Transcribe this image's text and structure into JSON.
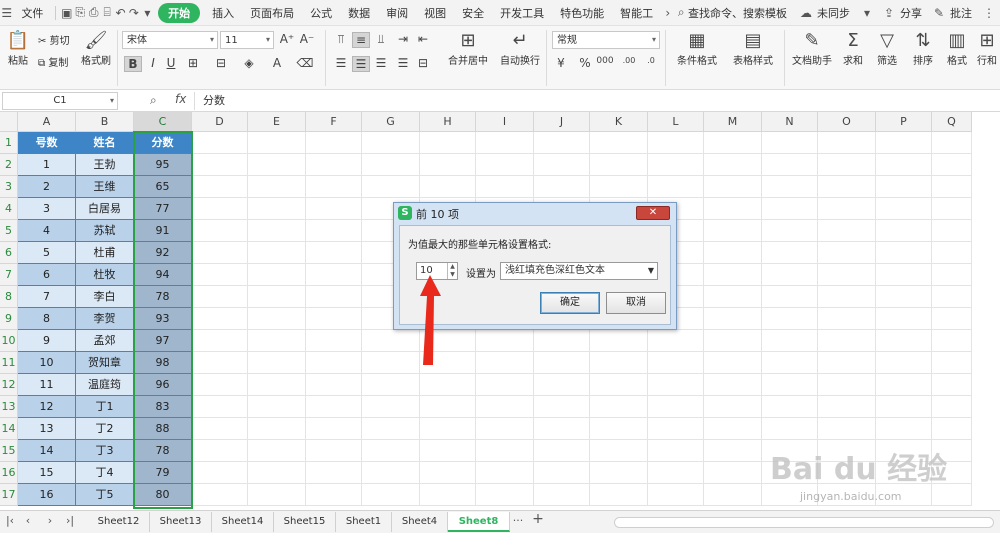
{
  "menubar": {
    "file": "文件",
    "tabs": [
      "开始",
      "插入",
      "页面布局",
      "公式",
      "数据",
      "审阅",
      "视图",
      "安全",
      "开发工具",
      "特色功能",
      "智能工"
    ],
    "active_tab": "开始",
    "search": "查找命令、搜索模板",
    "sync": "未同步",
    "share": "分享",
    "comment": "批注"
  },
  "ribbon": {
    "paste": "粘贴",
    "cut": "剪切",
    "copy": "复制",
    "format_painter": "格式刷",
    "font_name": "宋体",
    "font_size": "11",
    "merge_center": "合并居中",
    "wrap_text": "自动换行",
    "number_format": "常规",
    "conditional_format": "条件格式",
    "table_style": "表格样式",
    "doc_helper": "文档助手",
    "sum": "求和",
    "filter": "筛选",
    "sort": "排序",
    "format": "格式",
    "rows_cols": "行和"
  },
  "formula_bar": {
    "cell_ref": "C1",
    "value": "分数"
  },
  "columns": [
    "A",
    "B",
    "C",
    "D",
    "E",
    "F",
    "G",
    "H",
    "I",
    "J",
    "K",
    "L",
    "M",
    "N",
    "O",
    "P",
    "Q"
  ],
  "table": {
    "headers": [
      "号数",
      "姓名",
      "分数"
    ],
    "rows": [
      [
        "1",
        "王勃",
        "95"
      ],
      [
        "2",
        "王维",
        "65"
      ],
      [
        "3",
        "白居易",
        "77"
      ],
      [
        "4",
        "苏轼",
        "91"
      ],
      [
        "5",
        "杜甫",
        "92"
      ],
      [
        "6",
        "杜牧",
        "94"
      ],
      [
        "7",
        "李白",
        "78"
      ],
      [
        "8",
        "李贺",
        "93"
      ],
      [
        "9",
        "孟郊",
        "97"
      ],
      [
        "10",
        "贺知章",
        "98"
      ],
      [
        "11",
        "温庭筠",
        "96"
      ],
      [
        "12",
        "丁1",
        "83"
      ],
      [
        "13",
        "丁2",
        "88"
      ],
      [
        "14",
        "丁3",
        "78"
      ],
      [
        "15",
        "丁4",
        "79"
      ],
      [
        "16",
        "丁5",
        "80"
      ]
    ]
  },
  "dialog": {
    "title": "前 10 项",
    "close": "✕",
    "description": "为值最大的那些单元格设置格式:",
    "count": "10",
    "set_as": "设置为",
    "style_option": "浅红填充色深红色文本",
    "ok": "确定",
    "cancel": "取消"
  },
  "sheet_tabs": [
    "Sheet12",
    "Sheet13",
    "Sheet14",
    "Sheet15",
    "Sheet1",
    "Sheet4",
    "Sheet8"
  ],
  "active_sheet": "Sheet8",
  "more_tabs": "···",
  "add_tab": "+",
  "watermark": "Bai du 经验",
  "watermark_url": "jingyan.baidu.com",
  "colors": {
    "accent_green": "#2fb460",
    "header_blue": "#3d85c6",
    "row_light": "#dbe8f5",
    "row_mid": "#b9d2ea",
    "col_c": "#9fb6cc"
  }
}
